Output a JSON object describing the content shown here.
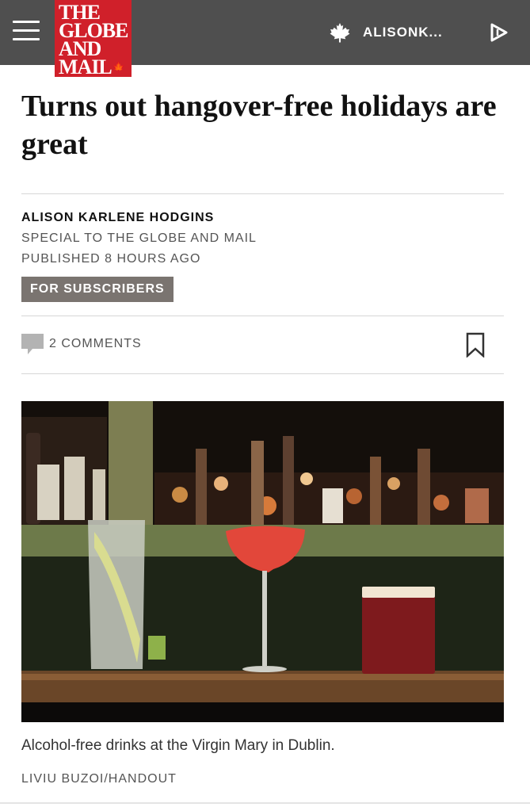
{
  "header": {
    "menu_icon": "hamburger-menu-icon",
    "logo_lines": [
      "THE",
      "GLOBE",
      "AND",
      "MAIL"
    ],
    "logo_leaf": "🍁",
    "user_icon": "maple-leaf-icon",
    "username": "ALISONK...",
    "play_icon": "play-icon"
  },
  "article": {
    "headline": "Turns out hangover-free holidays are great",
    "author": "ALISON KARLENE HODGINS",
    "affiliation": "SPECIAL TO THE GLOBE AND MAIL",
    "published": "PUBLISHED 8 HOURS AGO",
    "badge": "FOR SUBSCRIBERS",
    "comments": "2 COMMENTS",
    "comment_icon": "comment-bubble-icon",
    "bookmark_icon": "bookmark-icon"
  },
  "photo": {
    "caption": "Alcohol-free drinks at the Virgin Mary in Dublin.",
    "credit": "LIVIU BUZOI/HANDOUT"
  },
  "colors": {
    "header_bg": "#4f4f4f",
    "logo_red": "#d0202a",
    "badge_bg": "#7a7470"
  }
}
